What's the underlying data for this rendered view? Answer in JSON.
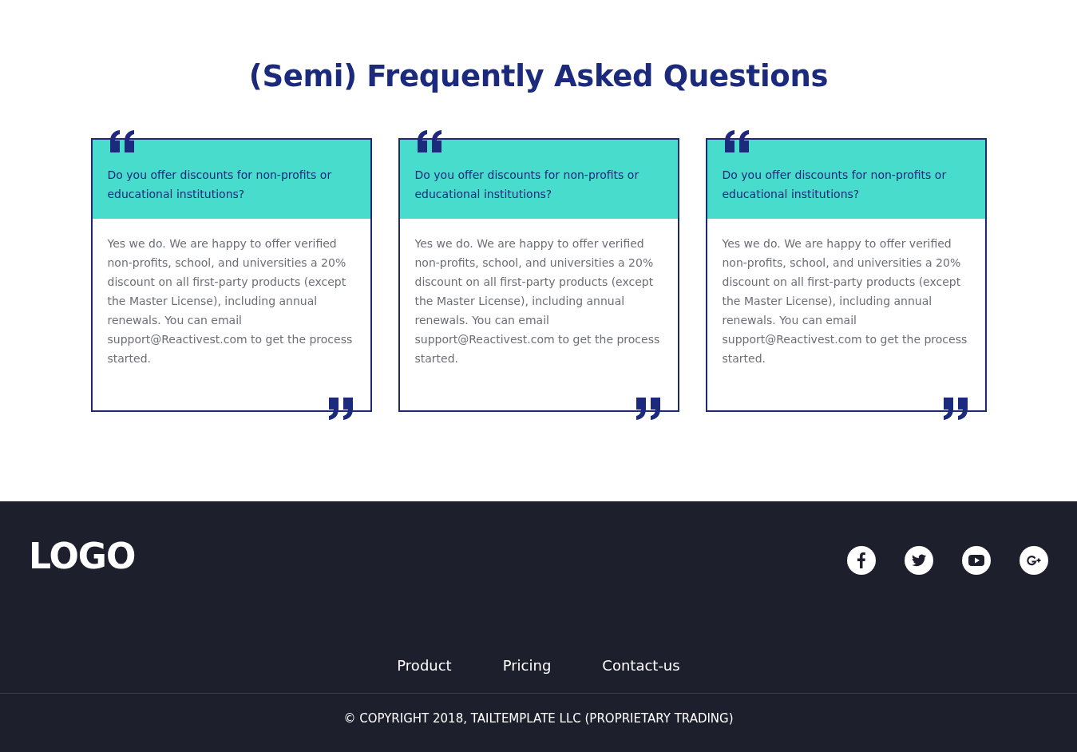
{
  "heading": "(Semi) Frequently Asked Questions",
  "faqs": [
    {
      "question": "Do you offer discounts for non-profits or educational institutions?",
      "answer": "Yes we do. We are happy to offer verified non-profits, school, and universities a 20% discount on all first-party products (except the Master License), including annual renewals. You can email support@Reactivest.com to get the process started."
    },
    {
      "question": "Do you offer discounts for non-profits or educational institutions?",
      "answer": "Yes we do. We are happy to offer verified non-profits, school, and universities a 20% discount on all first-party products (except the Master License), including annual renewals. You can email support@Reactivest.com to get the process started."
    },
    {
      "question": "Do you offer discounts for non-profits or educational institutions?",
      "answer": "Yes we do. We are happy to offer verified non-profits, school, and universities a 20% discount on all first-party products (except the Master License), including annual renewals. You can email support@Reactivest.com to get the process started."
    }
  ],
  "footer": {
    "logo": "LOGO",
    "social": [
      {
        "kind": "facebook"
      },
      {
        "kind": "twitter"
      },
      {
        "kind": "youtube"
      },
      {
        "kind": "googleplus"
      }
    ],
    "links": [
      "Product",
      "Pricing",
      "Contact-us"
    ],
    "copyright": "© COPYRIGHT 2018, TAILTEMPLATE LLC (PROPRIETARY TRADING)"
  }
}
